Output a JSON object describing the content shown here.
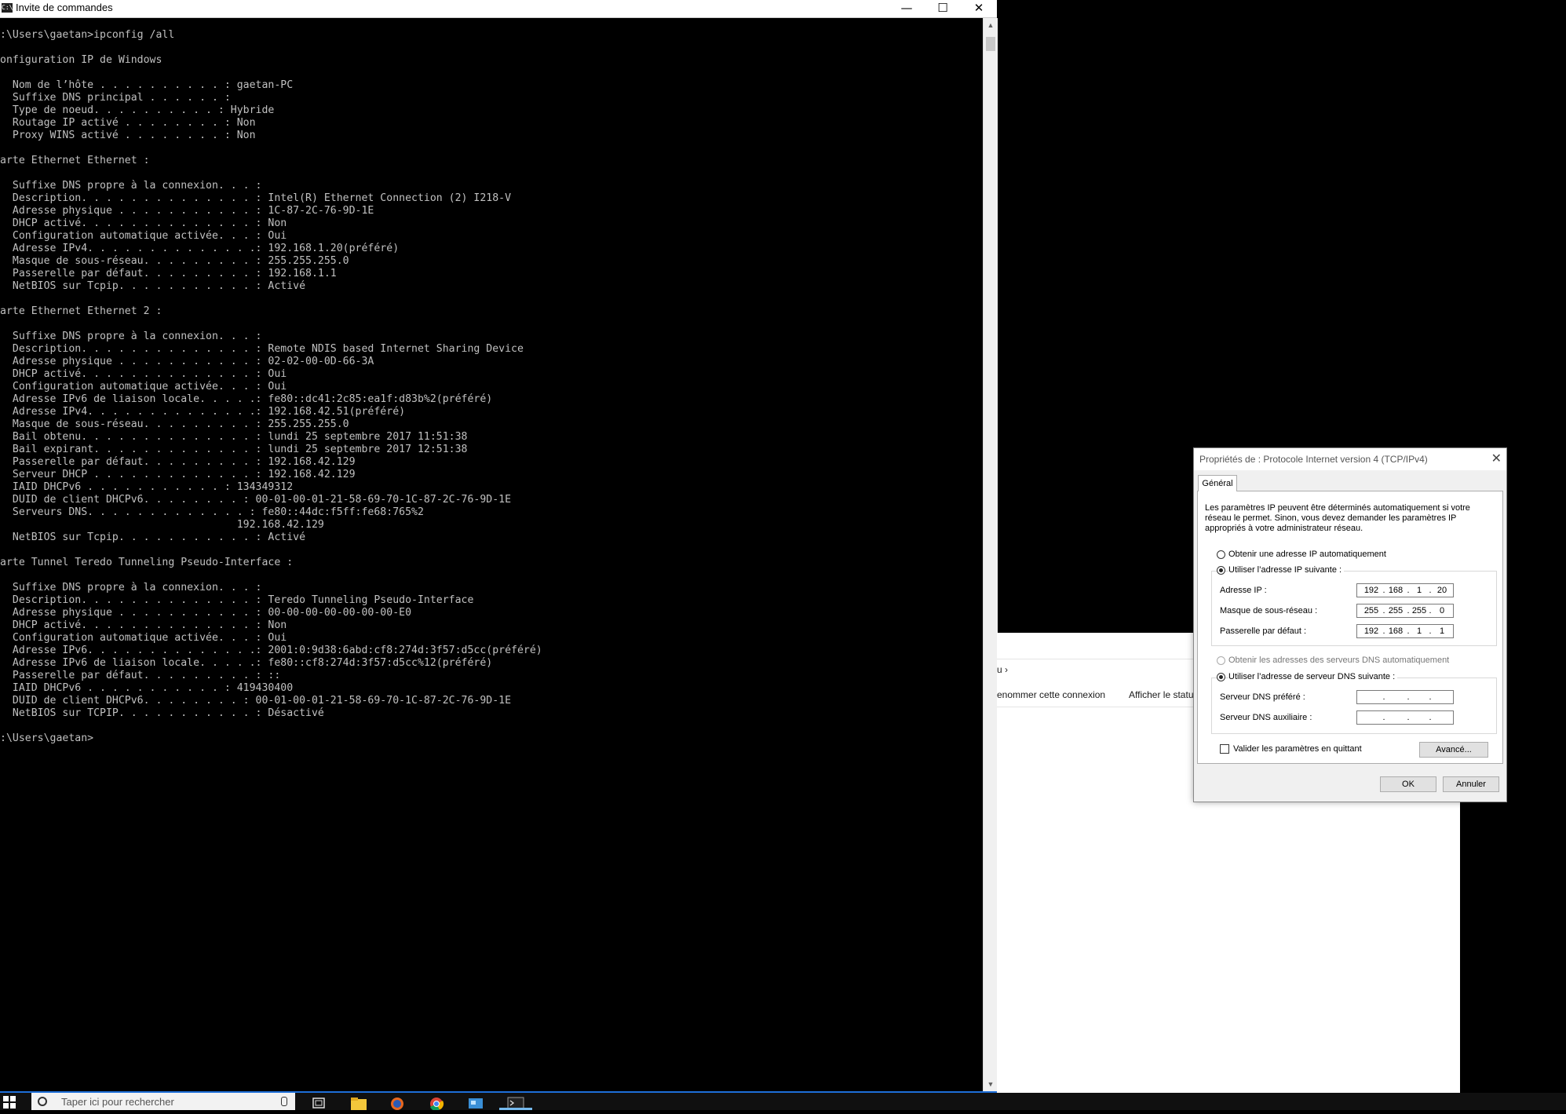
{
  "console_window": {
    "title": "Invite de commandes",
    "icon_text": "C:\\",
    "minimize": "—",
    "maximize": "☐",
    "close": "✕",
    "lines": [
      ":\\Users\\gaetan>ipconfig /all",
      "",
      "onfiguration IP de Windows",
      "",
      "  Nom de l’hôte . . . . . . . . . . : gaetan-PC",
      "  Suffixe DNS principal . . . . . . :",
      "  Type de noeud. . . . . . . . . . : Hybride",
      "  Routage IP activé . . . . . . . . : Non",
      "  Proxy WINS activé . . . . . . . . : Non",
      "",
      "arte Ethernet Ethernet :",
      "",
      "  Suffixe DNS propre à la connexion. . . :",
      "  Description. . . . . . . . . . . . . . : Intel(R) Ethernet Connection (2) I218-V",
      "  Adresse physique . . . . . . . . . . . : 1C-87-2C-76-9D-1E",
      "  DHCP activé. . . . . . . . . . . . . . : Non",
      "  Configuration automatique activée. . . : Oui",
      "  Adresse IPv4. . . . . . . . . . . . . .: 192.168.1.20(préféré)",
      "  Masque de sous-réseau. . . . . . . . . : 255.255.255.0",
      "  Passerelle par défaut. . . . . . . . . : 192.168.1.1",
      "  NetBIOS sur Tcpip. . . . . . . . . . . : Activé",
      "",
      "arte Ethernet Ethernet 2 :",
      "",
      "  Suffixe DNS propre à la connexion. . . :",
      "  Description. . . . . . . . . . . . . . : Remote NDIS based Internet Sharing Device",
      "  Adresse physique . . . . . . . . . . . : 02-02-00-0D-66-3A",
      "  DHCP activé. . . . . . . . . . . . . . : Oui",
      "  Configuration automatique activée. . . : Oui",
      "  Adresse IPv6 de liaison locale. . . . .: fe80::dc41:2c85:ea1f:d83b%2(préféré)",
      "  Adresse IPv4. . . . . . . . . . . . . .: 192.168.42.51(préféré)",
      "  Masque de sous-réseau. . . . . . . . . : 255.255.255.0",
      "  Bail obtenu. . . . . . . . . . . . . . : lundi 25 septembre 2017 11:51:38",
      "  Bail expirant. . . . . . . . . . . . . : lundi 25 septembre 2017 12:51:38",
      "  Passerelle par défaut. . . . . . . . . : 192.168.42.129",
      "  Serveur DHCP . . . . . . . . . . . . . : 192.168.42.129",
      "  IAID DHCPv6 . . . . . . . . . . . : 134349312",
      "  DUID de client DHCPv6. . . . . . . . : 00-01-00-01-21-58-69-70-1C-87-2C-76-9D-1E",
      "  Serveurs DNS. . . . . . . . . . . . . : fe80::44dc:f5ff:fe68:765%2",
      "                                      192.168.42.129",
      "  NetBIOS sur Tcpip. . . . . . . . . . . : Activé",
      "",
      "arte Tunnel Teredo Tunneling Pseudo-Interface :",
      "",
      "  Suffixe DNS propre à la connexion. . . :",
      "  Description. . . . . . . . . . . . . . : Teredo Tunneling Pseudo-Interface",
      "  Adresse physique . . . . . . . . . . . : 00-00-00-00-00-00-00-E0",
      "  DHCP activé. . . . . . . . . . . . . . : Non",
      "  Configuration automatique activée. . . : Oui",
      "  Adresse IPv6. . . . . . . . . . . . . .: 2001:0:9d38:6abd:cf8:274d:3f57:d5cc(préféré)",
      "  Adresse IPv6 de liaison locale. . . . .: fe80::cf8:274d:3f57:d5cc%12(préféré)",
      "  Passerelle par défaut. . . . . . . . . : ::",
      "  IAID DHCPv6 . . . . . . . . . . . : 419430400",
      "  DUID de client DHCPv6. . . . . . . . : 00-01-00-01-21-58-69-70-1C-87-2C-76-9D-1E",
      "  NetBIOS sur TCPIP. . . . . . . . . . . : Désactivé",
      "",
      ":\\Users\\gaetan>"
    ]
  },
  "explorer": {
    "breadcrumb": "u  ›",
    "rename_connection": "enommer cette connexion",
    "view_status": "Afficher le statu"
  },
  "dialog": {
    "title": "Propriétés de : Protocole Internet version 4 (TCP/IPv4)",
    "close": "✕",
    "tab_general": "Général",
    "description": "Les paramètres IP peuvent être déterminés automatiquement si votre réseau le permet. Sinon, vous devez demander les paramètres IP appropriés à votre administrateur réseau.",
    "radio_auto_ip": "Obtenir une adresse IP automatiquement",
    "radio_manual_ip": "Utiliser l’adresse IP suivante :",
    "label_ip": "Adresse IP :",
    "ip_address": [
      "192",
      "168",
      "1",
      "20"
    ],
    "label_mask": "Masque de sous-réseau :",
    "subnet_mask": [
      "255",
      "255",
      "255",
      "0"
    ],
    "label_gateway": "Passerelle par défaut :",
    "gateway": [
      "192",
      "168",
      "1",
      "1"
    ],
    "radio_auto_dns": "Obtenir les adresses des serveurs DNS automatiquement",
    "radio_manual_dns": "Utiliser l’adresse de serveur DNS suivante :",
    "label_dns_pref": "Serveur DNS préféré :",
    "label_dns_alt": "Serveur DNS auxiliaire :",
    "checkbox_validate": "Valider les paramètres en quittant",
    "btn_advanced": "Avancé...",
    "btn_ok": "OK",
    "btn_cancel": "Annuler"
  },
  "taskbar": {
    "search_placeholder": "Taper ici pour rechercher"
  },
  "colors": {
    "console_bg": "#000000",
    "console_fg": "#c0c0c0",
    "taskbar_bg": "#101010",
    "accent": "#1e6fd9"
  }
}
